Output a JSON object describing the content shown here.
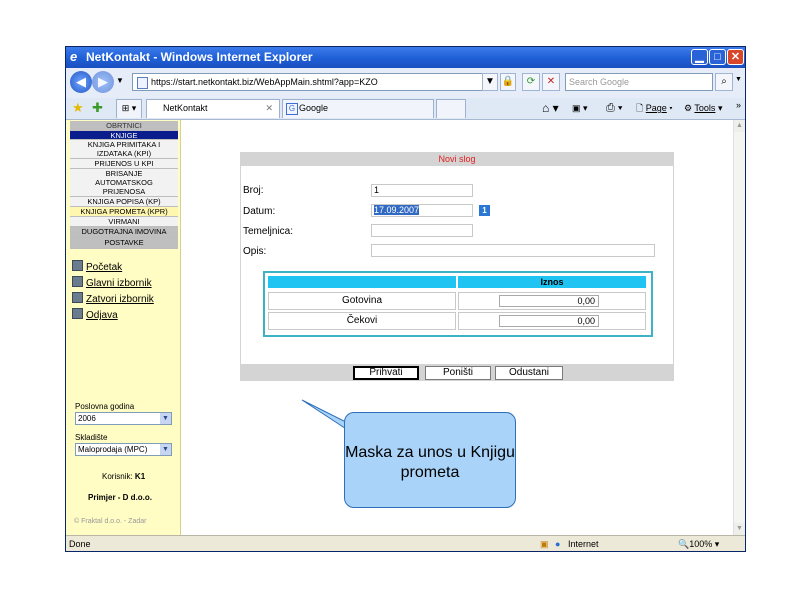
{
  "window": {
    "title": "NetKontakt - Windows Internet Explorer"
  },
  "browser": {
    "url": "https://start.netkontakt.biz/WebAppMain.shtml?app=KZO",
    "search_placeholder": "Search Google",
    "tabs": [
      {
        "label": "NetKontakt"
      },
      {
        "label": "Google"
      }
    ],
    "commands": {
      "page": "Page",
      "tools": "Tools"
    }
  },
  "sidebar": {
    "menu": [
      {
        "label": "OBRTNICI"
      },
      {
        "label": "KNJIGE"
      },
      {
        "label": "KNJIGA PRIMITAKA I IZDATAKA (KPI)"
      },
      {
        "label": "PRIJENOS U KPI"
      },
      {
        "label": "BRISANJE AUTOMATSKOG PRIJENOSA"
      },
      {
        "label": "KNJIGA POPISA (KP)"
      },
      {
        "label": "KNJIGA PROMETA (KPR)"
      },
      {
        "label": "VIRMANI"
      },
      {
        "label": "DUGOTRAJNA IMOVINA"
      },
      {
        "label": "POSTAVKE"
      }
    ],
    "links": [
      {
        "label": "Početak"
      },
      {
        "label": "Glavni izbornik"
      },
      {
        "label": "Zatvori izbornik"
      },
      {
        "label": "Odjava"
      }
    ],
    "year_label": "Poslovna godina",
    "year_value": "2006",
    "warehouse_label": "Skladište",
    "warehouse_value": "Maloprodaja (MPC)",
    "user_label": "Korisnik:",
    "user_value": "K1",
    "company": "Primjer - D d.o.o.",
    "footer": "© Fraktal d.o.o. - Zadar"
  },
  "form": {
    "title": "Novi slog",
    "fields": {
      "broj_label": "Broj:",
      "broj_value": "1",
      "datum_label": "Datum:",
      "datum_value": "17.09.2007",
      "temeljnica_label": "Temeljnica:",
      "temeljnica_value": "",
      "opis_label": "Opis:",
      "opis_value": ""
    },
    "table": {
      "headers": [
        "",
        "Iznos"
      ],
      "rows": [
        {
          "label": "Gotovina",
          "value": "0,00"
        },
        {
          "label": "Čekovi",
          "value": "0,00"
        }
      ]
    },
    "buttons": {
      "accept": "Prihvati",
      "cancel": "Poništi",
      "close": "Odustani"
    }
  },
  "status": {
    "left": "Done",
    "zone": "Internet",
    "zoom": "100%"
  },
  "callout": {
    "text": "Maska za unos u Knjigu prometa"
  },
  "colors": {
    "accent_blue": "#0a1d8c",
    "form_title_red": "#e0201e",
    "table_header_cyan": "#1fc4f3",
    "sidebar_yellow": "#fffcc4",
    "callout_blue": "#a9d3f8"
  }
}
